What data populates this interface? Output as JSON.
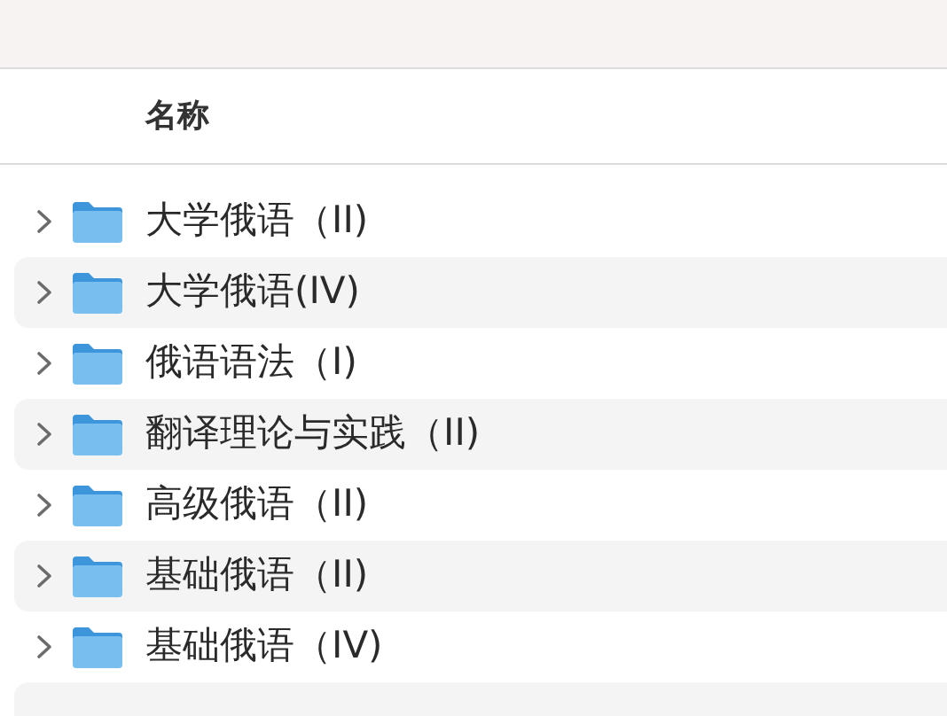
{
  "table": {
    "columns": [
      "名称"
    ],
    "rows": [
      {
        "name": "大学俄语（II)",
        "expanded": false
      },
      {
        "name": "大学俄语(IV)",
        "expanded": false
      },
      {
        "name": "俄语语法（I)",
        "expanded": false
      },
      {
        "name": "翻译理论与实践（II)",
        "expanded": false
      },
      {
        "name": "高级俄语（II)",
        "expanded": false
      },
      {
        "name": "基础俄语（II)",
        "expanded": false
      },
      {
        "name": "基础俄语（IV)",
        "expanded": false
      }
    ]
  }
}
